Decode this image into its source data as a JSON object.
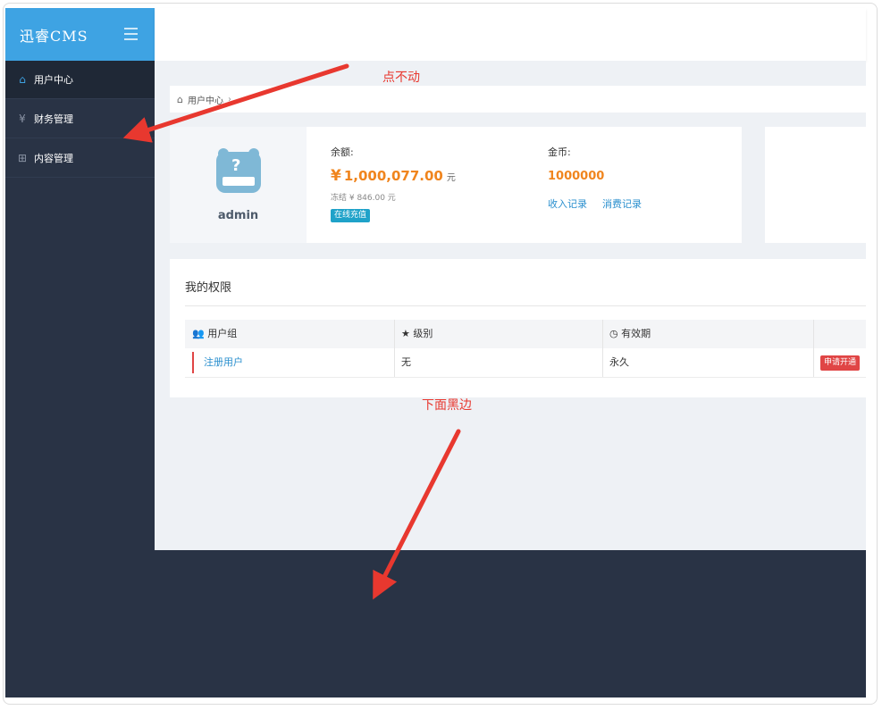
{
  "app": {
    "title": "迅睿CMS"
  },
  "sidebar": {
    "items": [
      {
        "label": "用户中心",
        "icon": "home-icon"
      },
      {
        "label": "财务管理",
        "icon": "yen-icon"
      },
      {
        "label": "内容管理",
        "icon": "grid-icon"
      }
    ]
  },
  "breadcrumb": {
    "home_label": "用户中心",
    "separator": "›"
  },
  "user": {
    "name": "admin",
    "balance_label": "余额:",
    "balance_currency": "¥",
    "balance_value": "1,000,077.00",
    "balance_unit": "元",
    "frozen_text": "冻结 ¥ 846.00 元",
    "recharge_label": "在线充值",
    "coin_label": "金币:",
    "coin_value": "1000000",
    "income_link": "收入记录",
    "expense_link": "消费记录"
  },
  "permissions": {
    "title": "我的权限",
    "headers": [
      "用户组",
      "级别",
      "有效期"
    ],
    "header_icons": [
      "users-icon",
      "star-icon",
      "clock-icon"
    ],
    "rows": [
      {
        "group": "注册用户",
        "level": "无",
        "validity": "永久",
        "action": "申请开通"
      }
    ]
  },
  "annotations": {
    "stuck": "点不动",
    "black_edge": "下面黑边"
  },
  "colors": {
    "accent": "#3ea3e3",
    "sidebar": "#293345",
    "orange": "#f0851e",
    "danger": "#e04545",
    "annotation": "#e8382f"
  }
}
